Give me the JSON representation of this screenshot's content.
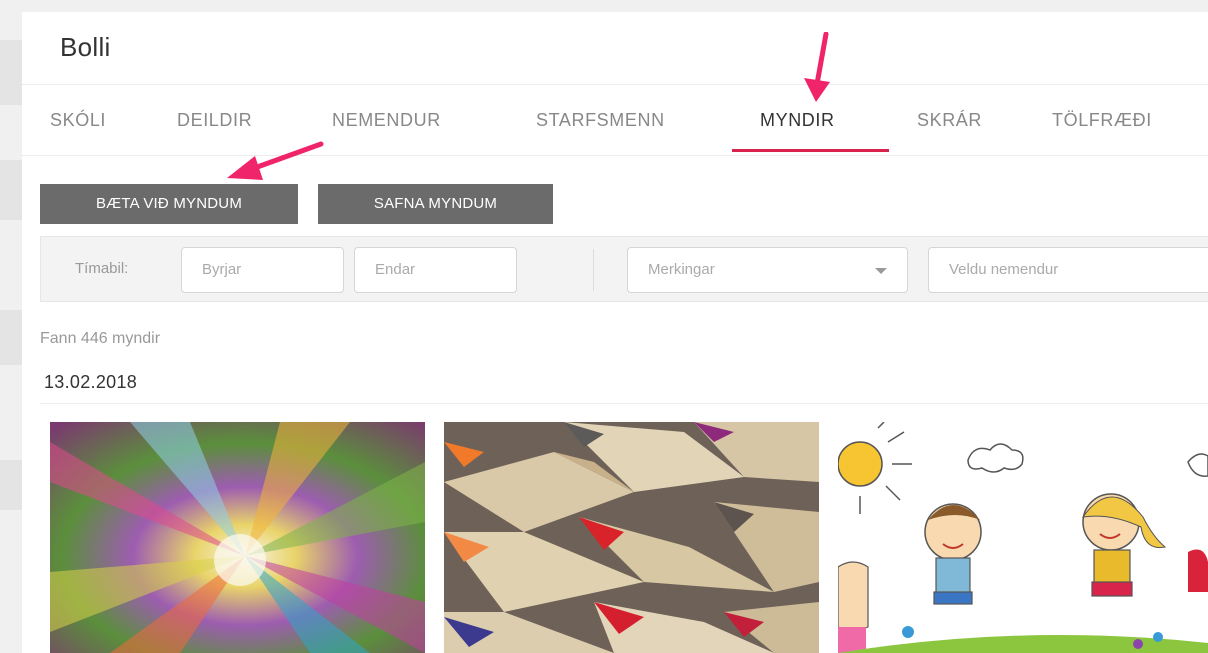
{
  "app": {
    "title": "Bolli"
  },
  "tabs": [
    {
      "label": "SKÓLI",
      "active": false
    },
    {
      "label": "DEILDIR",
      "active": false
    },
    {
      "label": "NEMENDUR",
      "active": false
    },
    {
      "label": "STARFSMENN",
      "active": false
    },
    {
      "label": "MYNDIR",
      "active": true
    },
    {
      "label": "SKRÁR",
      "active": false
    },
    {
      "label": "TÖLFRÆÐI",
      "active": false
    }
  ],
  "actions": {
    "add_photos": "BÆTA VIÐ MYNDUM",
    "collect_photos": "SAFNA MYNDUM"
  },
  "filters": {
    "period_label": "Tímabil:",
    "start_placeholder": "Byrjar",
    "end_placeholder": "Endar",
    "tags_placeholder": "Merkingar",
    "students_placeholder": "Veldu nemendur"
  },
  "results": {
    "count_text": "Fann 446 myndir",
    "date": "13.02.2018"
  },
  "colors": {
    "accent": "#d9234c",
    "button": "#6b6b6b",
    "arrow": "#f0246a"
  },
  "icons": {
    "dropdown": "chevron-down-icon",
    "annotation": "arrow-annotation-icon"
  }
}
